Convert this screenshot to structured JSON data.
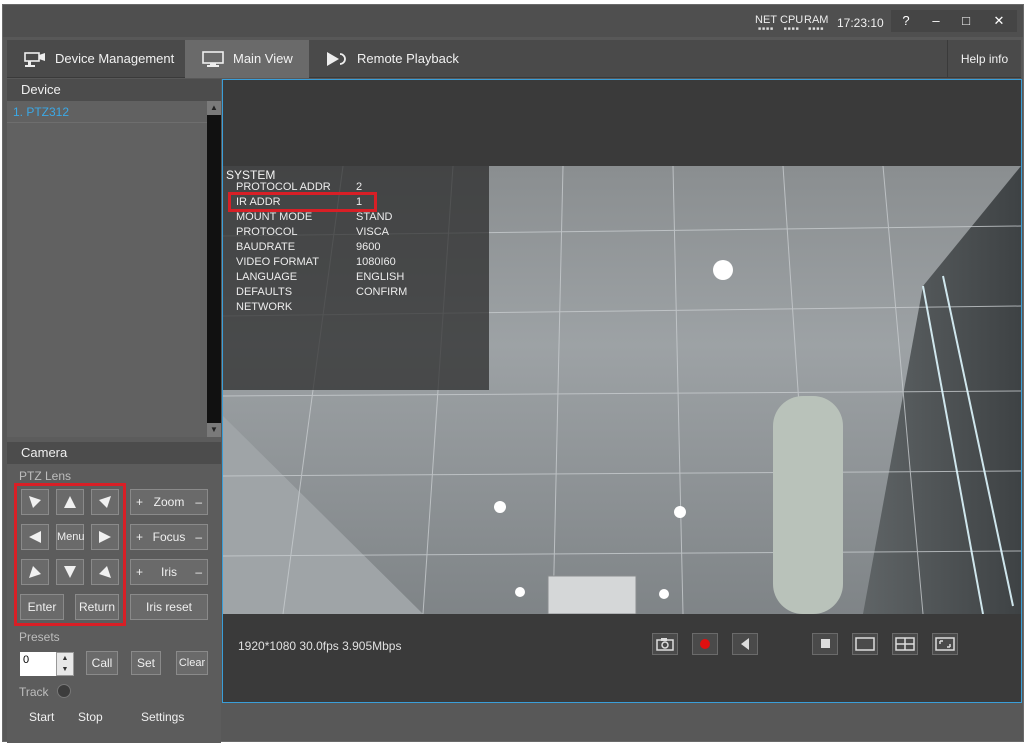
{
  "titlebar": {
    "stats": [
      "NET",
      "CPU",
      "RAM"
    ],
    "clock": "17:23:10",
    "help_btn": "?",
    "min_btn": "–",
    "max_btn": "□",
    "close_btn": "✕"
  },
  "nav": {
    "tabs": [
      {
        "label": "Device Management",
        "icon": "camera-device-icon"
      },
      {
        "label": "Main View",
        "icon": "monitor-icon"
      },
      {
        "label": "Remote Playback",
        "icon": "playback-icon"
      }
    ],
    "active_tab": "Main View",
    "help_info": "Help info"
  },
  "device": {
    "header": "Device",
    "items": [
      {
        "label": "1. PTZ312"
      }
    ]
  },
  "camera": {
    "header": "Camera",
    "ptz_label": "PTZ Lens",
    "menu_label": "Menu",
    "enter_label": "Enter",
    "return_label": "Return",
    "zoom_label": "Zoom",
    "focus_label": "Focus",
    "iris_label": "Iris",
    "plus": "+",
    "minus": "–",
    "iris_reset_label": "Iris reset",
    "presets_label": "Presets",
    "preset_value": "0",
    "call_label": "Call",
    "set_label": "Set",
    "clear_label": "Clear",
    "track_label": "Track",
    "start_label": "Start",
    "stop_label": "Stop",
    "settings_label": "Settings"
  },
  "osd": {
    "title": "SYSTEM",
    "rows": [
      {
        "key": "PROTOCOL ADDR",
        "value": "2"
      },
      {
        "key": "IR ADDR",
        "value": "1"
      },
      {
        "key": "MOUNT MODE",
        "value": "STAND"
      },
      {
        "key": "PROTOCOL",
        "value": "VISCA"
      },
      {
        "key": "BAUDRATE",
        "value": "9600"
      },
      {
        "key": "VIDEO FORMAT",
        "value": "1080I60"
      },
      {
        "key": "LANGUAGE",
        "value": "ENGLISH"
      },
      {
        "key": "DEFAULTS",
        "value": "CONFIRM"
      },
      {
        "key": "NETWORK",
        "value": ""
      }
    ],
    "highlighted_row": "IR ADDR"
  },
  "status": {
    "video_info": "1920*1080 30.0fps 3.905Mbps"
  },
  "toolbar": {
    "icons": [
      "snapshot-icon",
      "record-icon",
      "audio-icon",
      "layout-1x1-small-icon",
      "layout-single-icon",
      "layout-2x2-icon",
      "fullscreen-icon"
    ]
  },
  "colors": {
    "highlight_red": "#d81f26",
    "device_blue": "#3ba8e6",
    "accent_border": "#3a9ed8",
    "record_red": "#e01010"
  }
}
